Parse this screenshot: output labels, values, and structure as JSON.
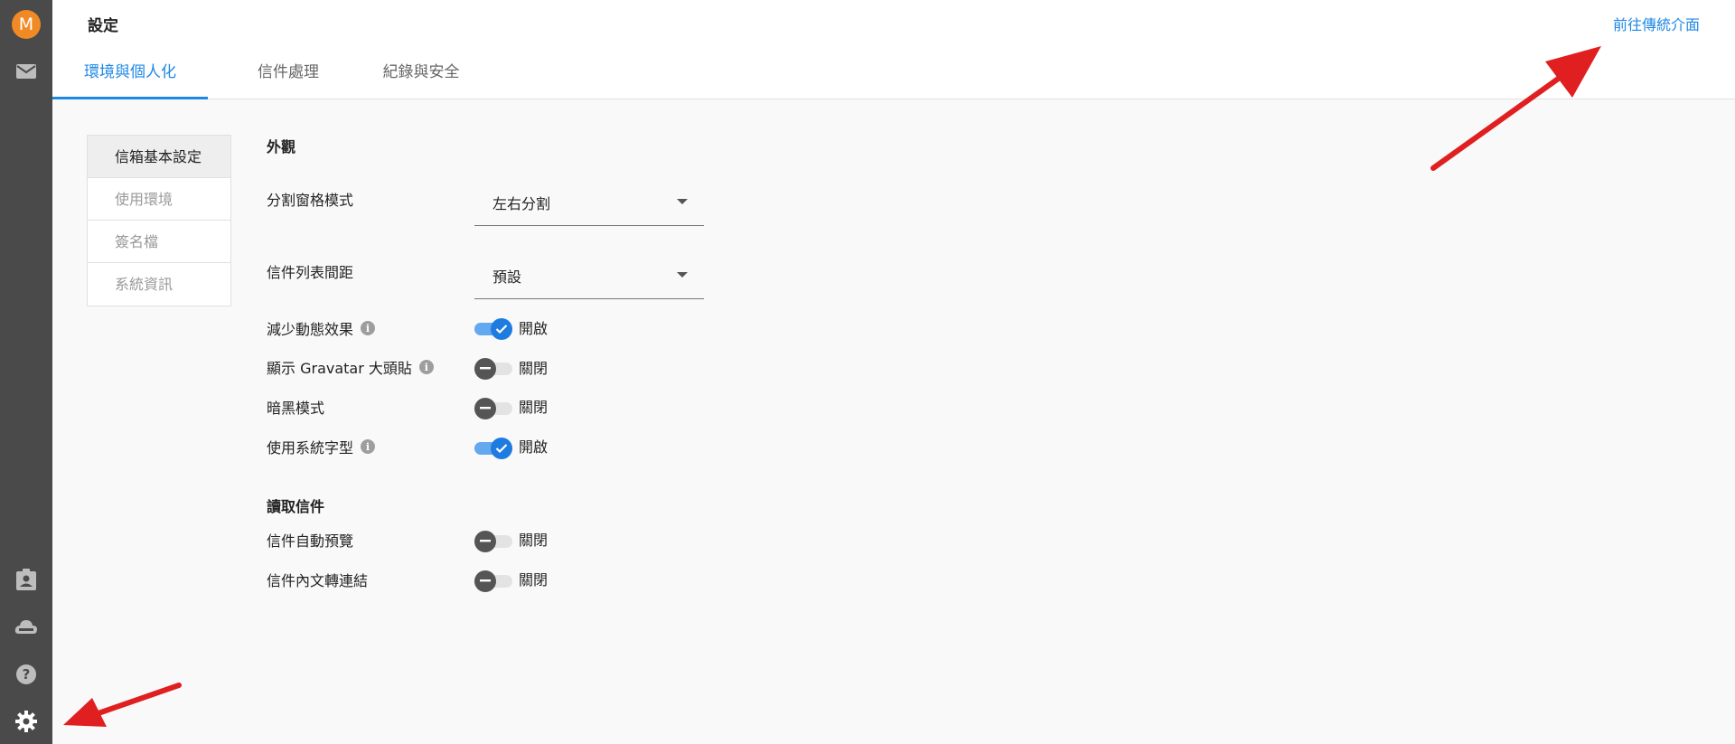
{
  "rail": {
    "avatar_letter": "M",
    "icons": [
      "mail-icon",
      "contacts-icon",
      "cloud-drive-icon",
      "help-icon",
      "gear-icon"
    ]
  },
  "header": {
    "title": "設定",
    "legacy_link": "前往傳統介面",
    "tabs": [
      "環境與個人化",
      "信件處理",
      "紀錄與安全"
    ]
  },
  "subnav": [
    "信箱基本設定",
    "使用環境",
    "簽名檔",
    "系統資訊"
  ],
  "appearance": {
    "title": "外觀",
    "split_label": "分割窗格模式",
    "split_value": "左右分割",
    "spacing_label": "信件列表間距",
    "spacing_value": "預設",
    "reduce_motion": {
      "label": "減少動態效果",
      "state": "開啟"
    },
    "gravatar": {
      "label": "顯示 Gravatar 大頭貼",
      "state": "關閉"
    },
    "dark_mode": {
      "label": "暗黑模式",
      "state": "關閉"
    },
    "system_font": {
      "label": "使用系統字型",
      "state": "開啟"
    }
  },
  "reading": {
    "title": "讀取信件",
    "auto_preview": {
      "label": "信件自動預覽",
      "state": "關閉"
    },
    "link_convert": {
      "label": "信件內文轉連結",
      "state": "關閉"
    }
  },
  "colors": {
    "accent": "#1e88e5",
    "rail": "#4a4a4a",
    "avatar": "#f08a24"
  }
}
